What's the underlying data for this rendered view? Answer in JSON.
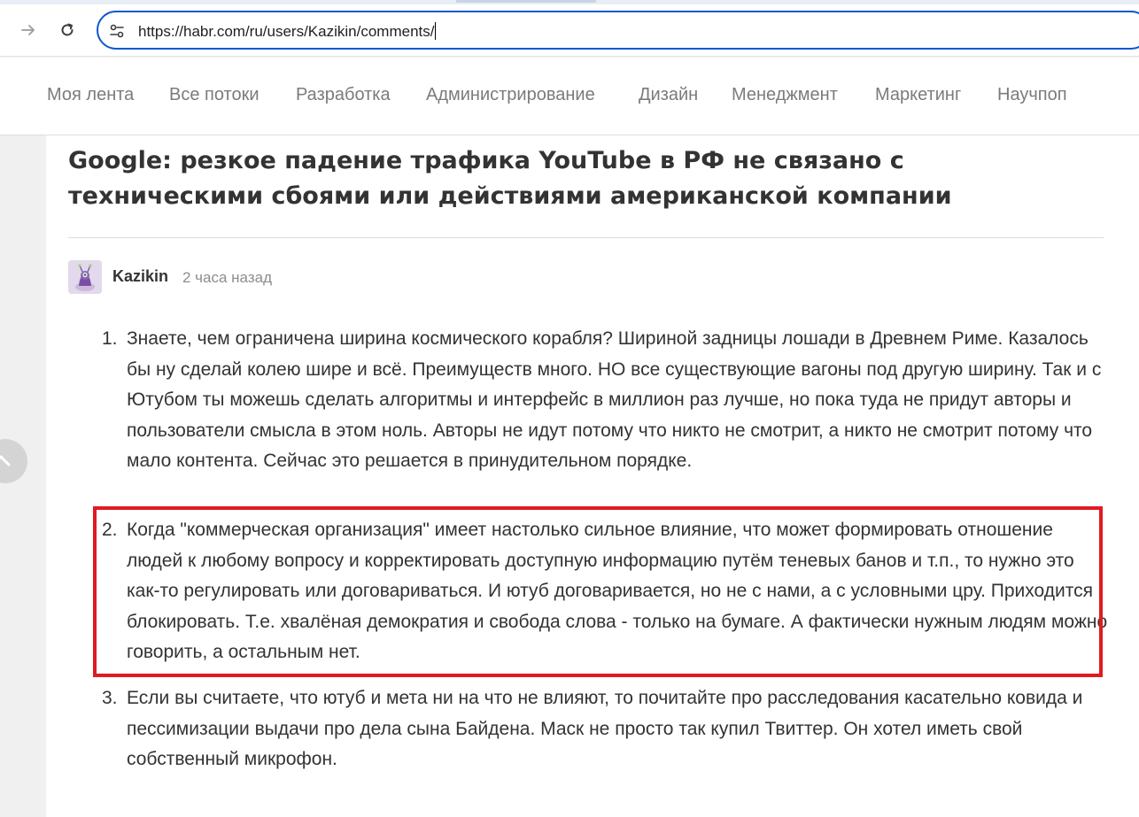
{
  "browser": {
    "url": "https://habr.com/ru/users/Kazikin/comments/",
    "icons": {
      "forward": "arrow-right-icon",
      "reload": "reload-icon",
      "site_info": "tune-icon"
    }
  },
  "site_nav": {
    "items": [
      {
        "label": "Моя лента"
      },
      {
        "label": "Все потоки"
      },
      {
        "label": "Разработка"
      },
      {
        "label": "Администрирование"
      },
      {
        "label": "Дизайн"
      },
      {
        "label": "Менеджмент"
      },
      {
        "label": "Маркетинг"
      },
      {
        "label": "Научпоп"
      }
    ]
  },
  "article": {
    "title": "Google: резкое падение трафика YouTube в РФ не связано с техническими сбоями или действиями американской компании"
  },
  "comment": {
    "author": "Kazikin",
    "time": "2 часа назад",
    "items": [
      {
        "number": "1.",
        "text": "Знаете, чем ограничена ширина космического корабля? Шириной задницы лошади в Древнем Риме. Казалось бы ну сделай колею шире и всё. Преимуществ много. НО все существующие вагоны под другую ширину. Так и с Ютубом ты можешь сделать алгоритмы и интерфейс в миллион раз лучше, но пока туда не придут авторы и пользователи смысла в этом ноль. Авторы не идут потому что никто не смотрит, а никто не смотрит потому что мало контента. Сейчас это решается в принудительном порядке."
      },
      {
        "number": "2.",
        "text": "Когда \"коммерческая организация\" имеет настолько сильное влияние, что может формировать отношение людей к любому вопросу и корректировать доступную информацию путём теневых банов и т.п., то нужно это как-то регулировать или договариваться. И ютуб договаривается, но не с нами, а с условными цру. Приходится блокировать. Т.е. хвалёная демократия и свобода слова - только на бумаге. А фактически нужным людям можно говорить, а остальным нет."
      },
      {
        "number": "3.",
        "text": "Если вы считаете, что ютуб и мета ни на что не влияют, то почитайте про расследования касательно ковида и пессимизации выдачи про дела сына Байдена. Маск не просто так купил Твиттер. Он хотел иметь свой собственный микрофон."
      }
    ]
  },
  "colors": {
    "highlight": "#e01a22",
    "omnibox_border": "#0b57d0",
    "nav_text": "#7b7b7b",
    "body_text": "#333333"
  }
}
